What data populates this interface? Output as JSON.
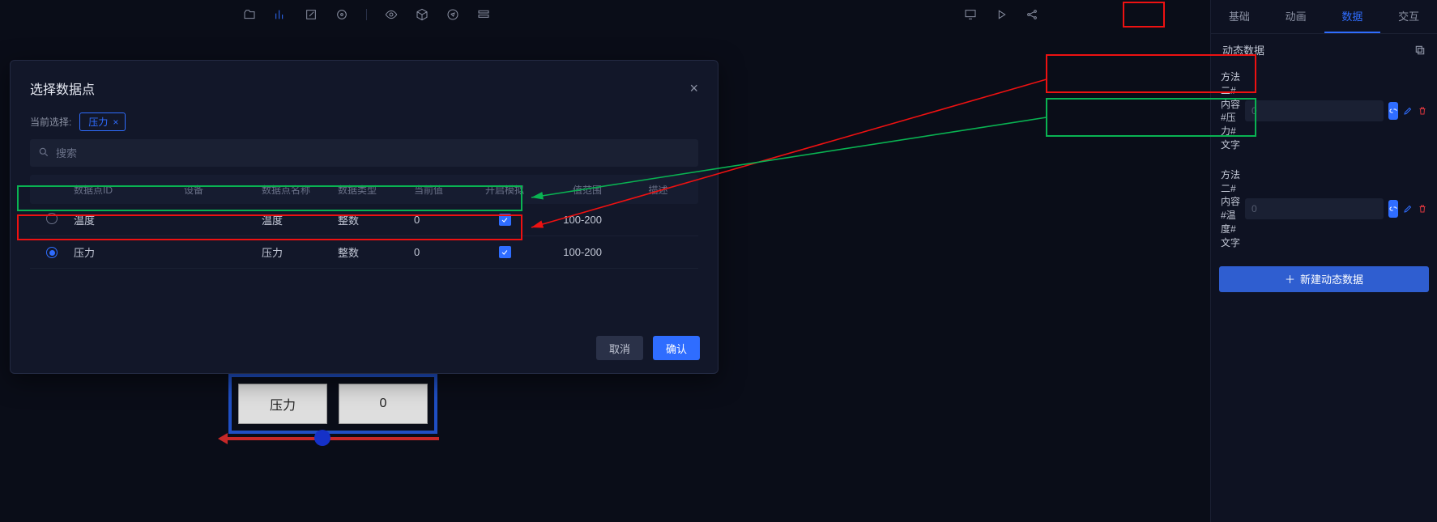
{
  "toolbar": {
    "icons_left": [
      "camera",
      "chart",
      "edit",
      "target",
      "eye",
      "cube",
      "compass",
      "layout"
    ],
    "icons_right": [
      "monitor",
      "play",
      "share"
    ]
  },
  "rightPanel": {
    "tabs": [
      "基础",
      "动画",
      "数据",
      "交互"
    ],
    "activeTab": 2,
    "sectionTitle": "动态数据",
    "rows": [
      {
        "label": "方法二#内容#压力#文字",
        "placeholder": "0"
      },
      {
        "label": "方法二#内容#温度#文字",
        "placeholder": "0"
      }
    ],
    "addBtn": "新建动态数据"
  },
  "modal": {
    "title": "选择数据点",
    "currentLabel": "当前选择:",
    "tag": "压力",
    "searchPlaceholder": "搜索",
    "columns": {
      "id": "数据点ID",
      "device": "设备",
      "name": "数据点名称",
      "type": "数据类型",
      "value": "当前值",
      "sim": "开启模拟",
      "range": "值范围",
      "desc": "描述"
    },
    "rows": [
      {
        "id": "温度",
        "device": "",
        "name": "温度",
        "type": "整数",
        "value": "0",
        "range": "100-200",
        "checked": false,
        "sim": true
      },
      {
        "id": "压力",
        "device": "",
        "name": "压力",
        "type": "整数",
        "value": "0",
        "range": "100-200",
        "checked": true,
        "sim": true
      }
    ],
    "cancel": "取消",
    "confirm": "确认"
  },
  "canvas": {
    "card1": "压力",
    "card2": "0"
  },
  "colors": {
    "accent": "#2f6dff",
    "red": "#d9363e",
    "green": "#09b352"
  }
}
